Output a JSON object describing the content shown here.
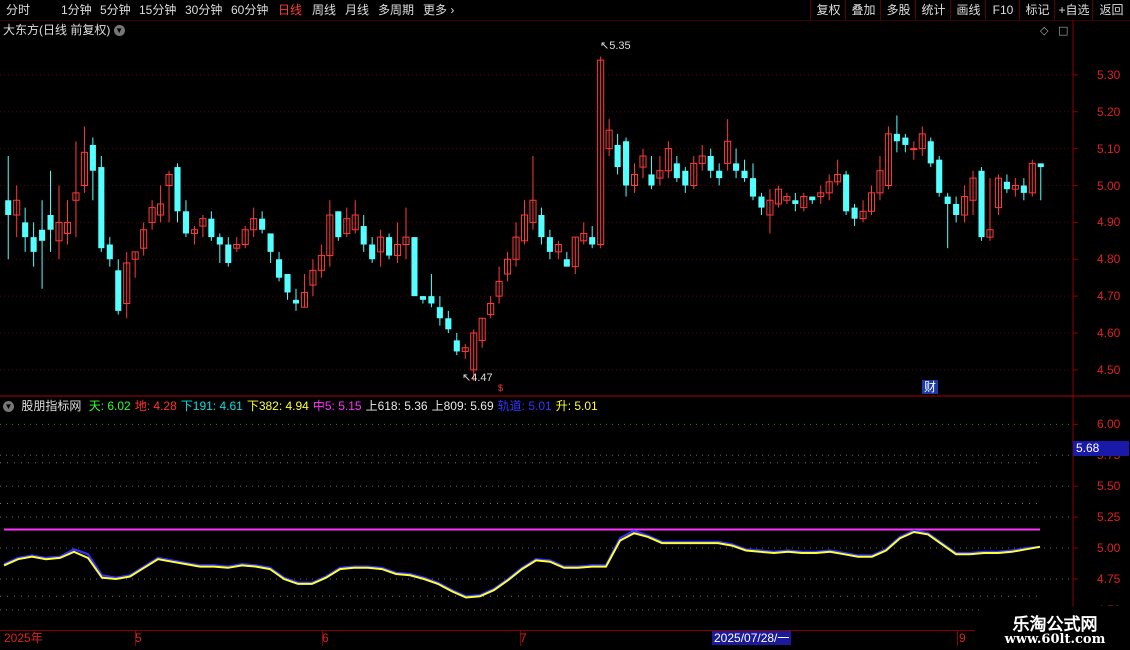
{
  "toolbar": {
    "periods": [
      "分时",
      "1分钟",
      "5分钟",
      "15分钟",
      "30分钟",
      "60分钟",
      "日线",
      "周线",
      "月线",
      "多周期",
      "更多"
    ],
    "active_index": 6,
    "more_arrow": "›",
    "right_buttons": [
      "复权",
      "叠加",
      "多股",
      "统计",
      "画线",
      "F10",
      "标记",
      "+自选",
      "返回"
    ]
  },
  "chart_title": "大东方(日线 前复权)",
  "indicator": {
    "name": "股朋指标网",
    "items": [
      {
        "label": "天: 6.02",
        "color": "#33ff33"
      },
      {
        "label": "地: 4.28",
        "color": "#ff3333"
      },
      {
        "label": "下191: 4.61",
        "color": "#00e0e0"
      },
      {
        "label": "下382: 4.94",
        "color": "#ffff33"
      },
      {
        "label": "中5: 5.15",
        "color": "#ff33ff"
      },
      {
        "label": "上618: 5.36",
        "color": "#e8e8e8"
      },
      {
        "label": "上809: 5.69",
        "color": "#e8e8e8"
      },
      {
        "label": "轨道: 5.01",
        "color": "#3333ff"
      },
      {
        "label": "升: 5.01",
        "color": "#ffff33"
      }
    ]
  },
  "price_axis": [
    "5.30",
    "5.20",
    "5.10",
    "5.00",
    "4.90",
    "4.80",
    "4.70",
    "4.60",
    "4.50"
  ],
  "ind_axis": [
    "6.00",
    "5.75",
    "5.50",
    "5.25",
    "5.00",
    "4.75",
    "4.50"
  ],
  "ind_price_flag": "5.68",
  "annotations": {
    "high": "5.35",
    "low": "4.47",
    "cai": "财"
  },
  "x_axis": {
    "labels": [
      "2025年",
      "5",
      "6",
      "7",
      "9"
    ],
    "cursor_date": "2025/07/28/一"
  },
  "watermark": {
    "line1": "乐淘公式网",
    "line2": "www.60lt.com"
  },
  "colors": {
    "up": "#ff3b3b",
    "down": "#54ffff",
    "yellow": "#ffff33",
    "blue": "#3333ff",
    "magenta": "#ff33ff"
  },
  "chart_data": {
    "type": "candlestick",
    "ylim": [
      4.44,
      5.4
    ],
    "candles": [
      [
        4.96,
        4.92,
        5.08,
        4.8
      ],
      [
        4.92,
        4.96,
        5.0,
        4.86
      ],
      [
        4.9,
        4.86,
        4.94,
        4.82
      ],
      [
        4.86,
        4.82,
        4.9,
        4.78
      ],
      [
        4.88,
        4.85,
        4.96,
        4.72
      ],
      [
        4.92,
        4.88,
        5.04,
        4.82
      ],
      [
        4.85,
        4.9,
        5.0,
        4.8
      ],
      [
        4.87,
        4.9,
        4.96,
        4.84
      ],
      [
        4.96,
        4.98,
        5.12,
        4.86
      ],
      [
        5.0,
        5.09,
        5.16,
        4.98
      ],
      [
        5.11,
        5.04,
        5.13,
        4.96
      ],
      [
        5.05,
        4.83,
        5.08,
        4.82
      ],
      [
        4.84,
        4.8,
        4.86,
        4.78
      ],
      [
        4.77,
        4.66,
        4.8,
        4.65
      ],
      [
        4.68,
        4.79,
        4.82,
        4.64
      ],
      [
        4.8,
        4.82,
        4.82,
        4.75
      ],
      [
        4.83,
        4.88,
        4.9,
        4.81
      ],
      [
        4.9,
        4.94,
        4.96,
        4.88
      ],
      [
        4.92,
        4.95,
        5.0,
        4.9
      ],
      [
        5.0,
        5.03,
        5.04,
        4.9
      ],
      [
        5.05,
        4.93,
        5.06,
        4.9
      ],
      [
        4.93,
        4.87,
        4.96,
        4.86
      ],
      [
        4.87,
        4.88,
        4.89,
        4.84
      ],
      [
        4.89,
        4.91,
        4.92,
        4.86
      ],
      [
        4.91,
        4.86,
        4.93,
        4.85
      ],
      [
        4.86,
        4.84,
        4.87,
        4.79
      ],
      [
        4.84,
        4.79,
        4.86,
        4.78
      ],
      [
        4.83,
        4.84,
        4.86,
        4.82
      ],
      [
        4.84,
        4.88,
        4.89,
        4.83
      ],
      [
        4.88,
        4.91,
        4.94,
        4.86
      ],
      [
        4.91,
        4.88,
        4.93,
        4.87
      ],
      [
        4.87,
        4.82,
        4.87,
        4.79
      ],
      [
        4.8,
        4.75,
        4.82,
        4.74
      ],
      [
        4.76,
        4.71,
        4.76,
        4.69
      ],
      [
        4.69,
        4.68,
        4.72,
        4.66
      ],
      [
        4.67,
        4.71,
        4.76,
        4.67
      ],
      [
        4.73,
        4.77,
        4.8,
        4.7
      ],
      [
        4.77,
        4.81,
        4.84,
        4.75
      ],
      [
        4.81,
        4.92,
        4.96,
        4.78
      ],
      [
        4.93,
        4.86,
        4.93,
        4.85
      ],
      [
        4.87,
        4.91,
        4.94,
        4.86
      ],
      [
        4.88,
        4.92,
        4.96,
        4.87
      ],
      [
        4.89,
        4.84,
        4.92,
        4.82
      ],
      [
        4.84,
        4.8,
        4.86,
        4.79
      ],
      [
        4.82,
        4.86,
        4.88,
        4.78
      ],
      [
        4.86,
        4.81,
        4.87,
        4.8
      ],
      [
        4.81,
        4.84,
        4.9,
        4.79
      ],
      [
        4.84,
        4.86,
        4.94,
        4.8
      ],
      [
        4.86,
        4.7,
        4.86,
        4.7
      ],
      [
        4.7,
        4.69,
        4.7,
        4.68
      ],
      [
        4.7,
        4.68,
        4.76,
        4.67
      ],
      [
        4.67,
        4.64,
        4.7,
        4.62
      ],
      [
        4.64,
        4.61,
        4.66,
        4.6
      ],
      [
        4.58,
        4.55,
        4.6,
        4.54
      ],
      [
        4.55,
        4.56,
        4.57,
        4.53
      ],
      [
        4.5,
        4.6,
        4.61,
        4.47
      ],
      [
        4.58,
        4.64,
        4.64,
        4.56
      ],
      [
        4.65,
        4.68,
        4.7,
        4.64
      ],
      [
        4.7,
        4.74,
        4.78,
        4.68
      ],
      [
        4.76,
        4.8,
        4.82,
        4.74
      ],
      [
        4.8,
        4.86,
        4.9,
        4.78
      ],
      [
        4.85,
        4.92,
        4.96,
        4.84
      ],
      [
        4.9,
        4.96,
        5.08,
        4.88
      ],
      [
        4.92,
        4.86,
        4.94,
        4.84
      ],
      [
        4.86,
        4.82,
        4.88,
        4.8
      ],
      [
        4.82,
        4.84,
        4.85,
        4.8
      ],
      [
        4.8,
        4.78,
        4.82,
        4.78
      ],
      [
        4.78,
        4.86,
        4.86,
        4.76
      ],
      [
        4.85,
        4.87,
        4.9,
        4.84
      ],
      [
        4.86,
        4.84,
        4.89,
        4.83
      ],
      [
        4.84,
        5.34,
        5.35,
        4.83
      ],
      [
        5.1,
        5.15,
        5.18,
        5.08
      ],
      [
        5.11,
        5.05,
        5.14,
        5.03
      ],
      [
        5.12,
        5.0,
        5.13,
        4.97
      ],
      [
        5.0,
        5.03,
        5.06,
        4.98
      ],
      [
        5.05,
        5.08,
        5.1,
        5.02
      ],
      [
        5.03,
        5.0,
        5.08,
        4.99
      ],
      [
        5.02,
        5.04,
        5.08,
        5.0
      ],
      [
        5.04,
        5.1,
        5.12,
        5.02
      ],
      [
        5.06,
        5.02,
        5.08,
        5.01
      ],
      [
        5.04,
        5.0,
        5.05,
        4.98
      ],
      [
        5.0,
        5.06,
        5.08,
        4.99
      ],
      [
        5.06,
        5.08,
        5.11,
        5.04
      ],
      [
        5.08,
        5.04,
        5.1,
        5.02
      ],
      [
        5.04,
        5.02,
        5.06,
        5.0
      ],
      [
        5.06,
        5.12,
        5.18,
        5.04
      ],
      [
        5.06,
        5.04,
        5.1,
        5.02
      ],
      [
        5.04,
        5.02,
        5.07,
        5.01
      ],
      [
        5.02,
        4.97,
        5.06,
        4.96
      ],
      [
        4.97,
        4.94,
        4.98,
        4.92
      ],
      [
        4.92,
        4.96,
        4.99,
        4.87
      ],
      [
        4.95,
        4.99,
        5.0,
        4.94
      ],
      [
        4.96,
        4.97,
        4.98,
        4.95
      ],
      [
        4.96,
        4.95,
        4.98,
        4.93
      ],
      [
        4.94,
        4.97,
        4.98,
        4.93
      ],
      [
        4.97,
        4.96,
        4.97,
        4.95
      ],
      [
        4.97,
        4.98,
        5.0,
        4.95
      ],
      [
        4.98,
        5.01,
        5.03,
        4.96
      ],
      [
        5.01,
        5.03,
        5.07,
        5.0
      ],
      [
        5.03,
        4.93,
        5.04,
        4.92
      ],
      [
        4.94,
        4.91,
        4.95,
        4.89
      ],
      [
        4.91,
        4.93,
        4.96,
        4.9
      ],
      [
        4.93,
        4.98,
        5.0,
        4.92
      ],
      [
        4.98,
        5.04,
        5.08,
        4.96
      ],
      [
        5.0,
        5.14,
        5.16,
        4.99
      ],
      [
        5.14,
        5.12,
        5.19,
        5.09
      ],
      [
        5.13,
        5.11,
        5.14,
        5.09
      ],
      [
        5.1,
        5.1,
        5.12,
        5.07
      ],
      [
        5.1,
        5.14,
        5.16,
        5.08
      ],
      [
        5.12,
        5.06,
        5.13,
        5.05
      ],
      [
        5.07,
        4.98,
        5.08,
        4.97
      ],
      [
        4.97,
        4.95,
        4.98,
        4.83
      ],
      [
        4.95,
        4.92,
        4.97,
        4.9
      ],
      [
        4.92,
        4.97,
        5.0,
        4.9
      ],
      [
        4.96,
        5.02,
        5.04,
        4.92
      ],
      [
        5.04,
        4.86,
        5.05,
        4.85
      ],
      [
        4.86,
        4.88,
        5.02,
        4.85
      ],
      [
        4.94,
        5.02,
        5.03,
        4.92
      ],
      [
        5.01,
        4.99,
        5.03,
        4.98
      ],
      [
        4.99,
        5.0,
        5.02,
        4.97
      ],
      [
        5.0,
        4.98,
        5.02,
        4.96
      ],
      [
        4.98,
        5.06,
        5.07,
        4.97
      ],
      [
        5.06,
        5.05,
        5.06,
        4.96
      ]
    ],
    "indicator_ylim": [
      4.58,
      6.1
    ],
    "series": [
      {
        "name": "中5",
        "values": [
          5.15
        ]
      },
      {
        "name": "轨道",
        "values": [
          4.87,
          4.92,
          4.94,
          4.92,
          4.93,
          4.99,
          4.95,
          4.78,
          4.76,
          4.78,
          4.85,
          4.92,
          4.9,
          4.88,
          4.86,
          4.86,
          4.85,
          4.87,
          4.86,
          4.84,
          4.76,
          4.72,
          4.72,
          4.77,
          4.84,
          4.85,
          4.85,
          4.84,
          4.8,
          4.79,
          4.76,
          4.72,
          4.66,
          4.61,
          4.62,
          4.67,
          4.75,
          4.84,
          4.91,
          4.9,
          4.85,
          4.85,
          4.86,
          4.86,
          5.08,
          5.14,
          5.1,
          5.05,
          5.05,
          5.05,
          5.05,
          5.05,
          5.03,
          4.99,
          4.98,
          4.97,
          4.98,
          4.97,
          4.97,
          4.98,
          4.96,
          4.94,
          4.94,
          4.99,
          5.09,
          5.14,
          5.12,
          5.04,
          4.96,
          4.96,
          4.97,
          4.97,
          4.98,
          5.0,
          5.01
        ]
      },
      {
        "name": "升",
        "values": [
          4.86,
          4.91,
          4.93,
          4.91,
          4.92,
          4.97,
          4.92,
          4.76,
          4.75,
          4.77,
          4.84,
          4.91,
          4.89,
          4.87,
          4.85,
          4.85,
          4.84,
          4.86,
          4.85,
          4.83,
          4.75,
          4.71,
          4.71,
          4.76,
          4.83,
          4.84,
          4.84,
          4.83,
          4.79,
          4.78,
          4.75,
          4.71,
          4.65,
          4.6,
          4.61,
          4.66,
          4.74,
          4.83,
          4.9,
          4.89,
          4.84,
          4.84,
          4.85,
          4.85,
          5.06,
          5.12,
          5.09,
          5.04,
          5.04,
          5.04,
          5.04,
          5.04,
          5.02,
          4.98,
          4.97,
          4.96,
          4.97,
          4.96,
          4.96,
          4.97,
          4.95,
          4.93,
          4.93,
          4.98,
          5.08,
          5.13,
          5.11,
          5.03,
          4.95,
          4.95,
          4.96,
          4.96,
          4.97,
          4.99,
          5.01
        ]
      }
    ]
  }
}
